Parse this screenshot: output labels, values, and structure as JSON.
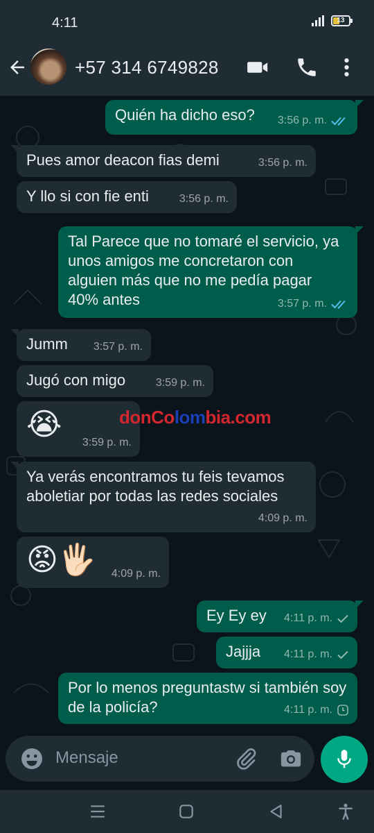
{
  "status": {
    "time": "4:11",
    "battery": "13"
  },
  "header": {
    "contact": "+57 314 6749828"
  },
  "messages": [
    {
      "dir": "out",
      "text": "Quién ha dicho eso?",
      "time": "3:56 p. m.",
      "status": "read"
    },
    {
      "dir": "in",
      "text": "Pues amor deacon fias demi",
      "time": "3:56 p. m."
    },
    {
      "dir": "in",
      "text": "Y llo si con fie enti",
      "time": "3:56 p. m."
    },
    {
      "dir": "out",
      "text": "Tal Parece que no tomaré el servicio, ya unos amigos me concretaron con alguien más que no me pedía pagar 40% antes",
      "time": "3:57 p. m.",
      "status": "read"
    },
    {
      "dir": "in",
      "text": "Jumm",
      "time": "3:57 p. m."
    },
    {
      "dir": "in",
      "text": "Jugó con migo",
      "time": "3:59 p. m."
    },
    {
      "dir": "in",
      "text": "😭",
      "time": "3:59 p. m."
    },
    {
      "dir": "in",
      "text": "Ya verás encontramos tu feis tevamos aboletiar por todas las redes sociales",
      "time": "4:09 p. m."
    },
    {
      "dir": "in",
      "text": "😡🖐🏻",
      "time": "4:09 p. m."
    },
    {
      "dir": "out",
      "text": "Ey Ey ey",
      "time": "4:11 p. m.",
      "status": "sent"
    },
    {
      "dir": "out",
      "text": "Jajjja",
      "time": "4:11 p. m.",
      "status": "sent"
    },
    {
      "dir": "out",
      "text": "Por lo menos preguntastw si también soy de la policía?",
      "time": "4:11 p. m.",
      "status": "pending"
    }
  ],
  "watermark": {
    "part1": "donCo",
    "part2": "lom",
    "part3": "bia.com"
  },
  "input": {
    "placeholder": "Mensaje"
  },
  "colors": {
    "outgoing": "#005c4b",
    "incoming": "#202c33",
    "accent": "#00a884",
    "read_tick": "#53bdeb"
  },
  "icons": [
    "back-arrow-icon",
    "video-call-icon",
    "phone-icon",
    "more-vert-icon",
    "emoji-icon",
    "attach-icon",
    "camera-icon",
    "mic-icon"
  ]
}
